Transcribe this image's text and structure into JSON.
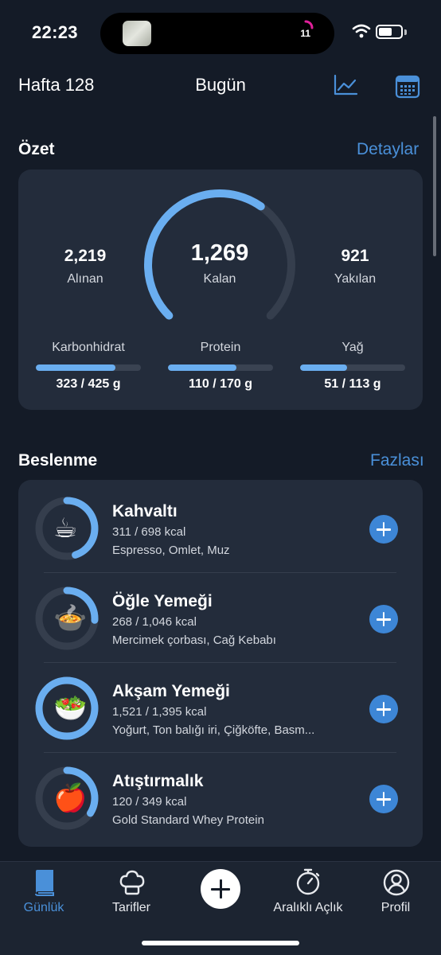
{
  "status": {
    "time": "22:23",
    "activity_count": "11"
  },
  "header": {
    "week": "Hafta 128",
    "title": "Bugün",
    "chart_icon": "line-chart-icon",
    "calendar_icon": "calendar-icon"
  },
  "summary": {
    "title": "Özet",
    "link": "Detaylar",
    "consumed": {
      "value": "2,219",
      "label": "Alınan"
    },
    "remaining": {
      "value": "1,269",
      "label": "Kalan",
      "progress": 0.63
    },
    "burned": {
      "value": "921",
      "label": "Yakılan"
    },
    "macros": [
      {
        "label": "Karbonhidrat",
        "value": "323 / 425 g",
        "progress": 0.76
      },
      {
        "label": "Protein",
        "value": "110 / 170 g",
        "progress": 0.65
      },
      {
        "label": "Yağ",
        "value": "51 / 113 g",
        "progress": 0.45
      }
    ]
  },
  "nutrition": {
    "title": "Beslenme",
    "link": "Fazlası",
    "meals": [
      {
        "name": "Kahvaltı",
        "kcal": "311 / 698 kcal",
        "items": "Espresso, Omlet, Muz",
        "emoji": "☕",
        "progress": 0.45
      },
      {
        "name": "Öğle Yemeği",
        "kcal": "268 / 1,046 kcal",
        "items": "Mercimek çorbası, Cağ Kebabı",
        "emoji": "🍲",
        "progress": 0.26
      },
      {
        "name": "Akşam Yemeği",
        "kcal": "1,521 / 1,395 kcal",
        "items": "Yoğurt, Ton balığı iri, Çiğköfte, Basm...",
        "emoji": "🥗",
        "progress": 1.0
      },
      {
        "name": "Atıştırmalık",
        "kcal": "120 / 349 kcal",
        "items": "Gold Standard Whey Protein",
        "emoji": "🍎",
        "progress": 0.34
      }
    ]
  },
  "tabbar": {
    "tabs": [
      {
        "label": "Günlük",
        "icon": "book-icon",
        "active": true
      },
      {
        "label": "Tarifler",
        "icon": "chef-hat-icon",
        "active": false
      },
      {
        "label": "",
        "icon": "plus-icon",
        "active": false
      },
      {
        "label": "Aralıklı Açlık",
        "icon": "stopwatch-icon",
        "active": false
      },
      {
        "label": "Profil",
        "icon": "person-icon",
        "active": false
      }
    ]
  },
  "colors": {
    "accent": "#4a90d9",
    "ring": "#6aaef0",
    "card": "#232c3b",
    "background": "#141b27"
  }
}
